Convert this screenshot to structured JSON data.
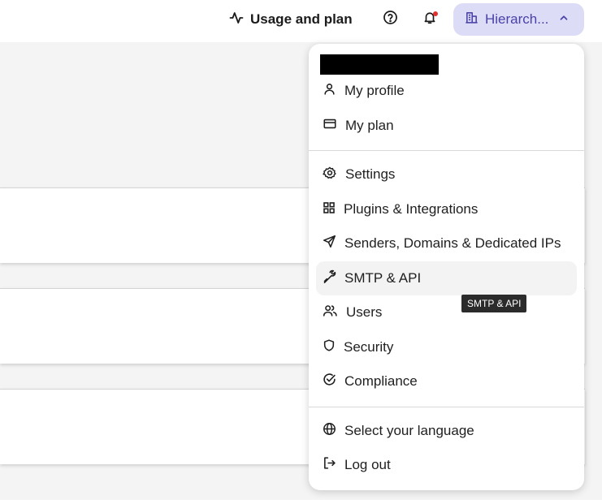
{
  "header": {
    "usage_label": "Usage and plan",
    "account_label": "Hierarch...",
    "accent_color": "#4a42a8",
    "account_bg": "#dcdcf6",
    "notification_dot_color": "#e03131"
  },
  "menu": {
    "user_name_redacted": true,
    "items": [
      {
        "label": "My profile",
        "icon": "person-icon"
      },
      {
        "label": "My plan",
        "icon": "credit-card-icon"
      },
      {
        "label": "Settings",
        "icon": "gear-icon"
      },
      {
        "label": "Plugins & Integrations",
        "icon": "grid-icon"
      },
      {
        "label": "Senders, Domains & Dedicated IPs",
        "icon": "paper-plane-icon"
      },
      {
        "label": "SMTP & API",
        "icon": "wrench-icon"
      },
      {
        "label": "Users",
        "icon": "users-icon"
      },
      {
        "label": "Security",
        "icon": "shield-icon"
      },
      {
        "label": "Compliance",
        "icon": "check-circle-icon"
      },
      {
        "label": "Select your language",
        "icon": "globe-icon"
      },
      {
        "label": "Log out",
        "icon": "logout-icon"
      }
    ],
    "hovered_item": "SMTP & API",
    "tooltip": "SMTP & API"
  }
}
